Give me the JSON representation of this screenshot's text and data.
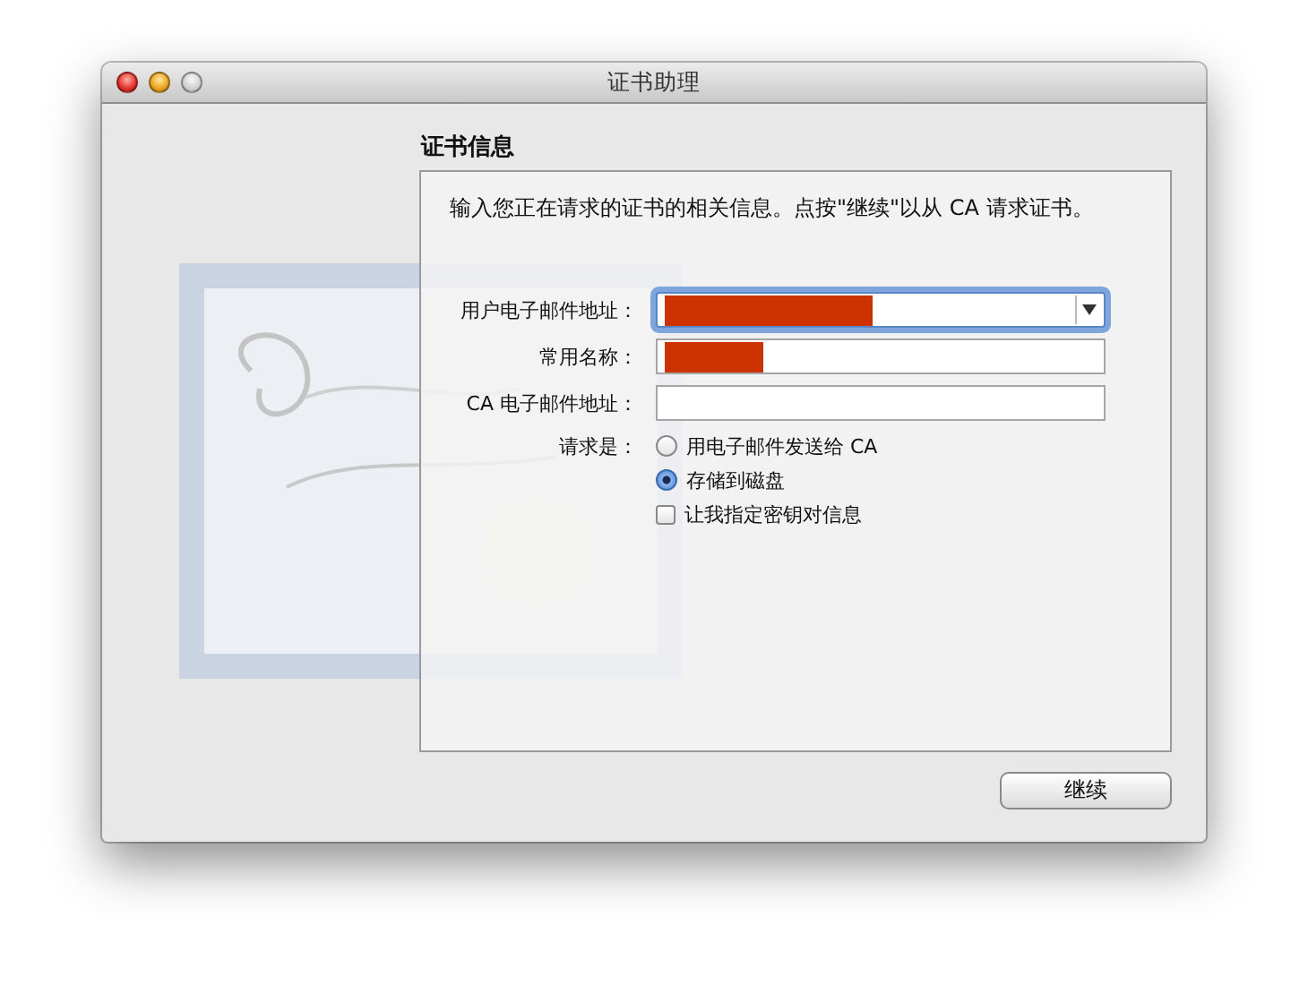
{
  "window": {
    "title": "证书助理",
    "zoom_enabled": false
  },
  "section_title": "证书信息",
  "intro": "输入您正在请求的证书的相关信息。点按\"继续\"以从 CA 请求证书。",
  "fields": [
    {
      "kind": "combo",
      "label": "用户电子邮件地址：",
      "redacted": true,
      "focused": true
    },
    {
      "kind": "text",
      "label": "常用名称：",
      "redacted": true,
      "focused": false
    },
    {
      "kind": "text",
      "label": "CA 电子邮件地址：",
      "redacted": false,
      "focused": false
    }
  ],
  "request": {
    "label": "请求是：",
    "options": [
      {
        "label": "用电子邮件发送给 CA",
        "selected": false
      },
      {
        "label": "存储到磁盘",
        "selected": true
      }
    ]
  },
  "checkbox": {
    "label": "让我指定密钥对信息",
    "checked": false
  },
  "button": "继续"
}
